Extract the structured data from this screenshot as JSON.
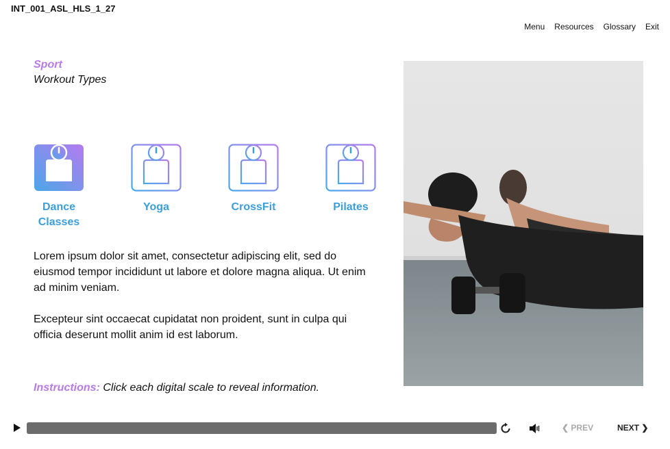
{
  "header": {
    "course_id": "INT_001_ASL_HLS_1_27",
    "nav": [
      "Menu",
      "Resources",
      "Glossary",
      "Exit"
    ]
  },
  "main": {
    "category": "Sport",
    "title": "Workout Types",
    "scales": [
      {
        "label": "Dance Classes",
        "active": true
      },
      {
        "label": "Yoga",
        "active": false
      },
      {
        "label": "CrossFit",
        "active": false
      },
      {
        "label": "Pilates",
        "active": false
      }
    ],
    "paragraphs": [
      "Lorem ipsum dolor sit amet, consectetur adipiscing elit, sed do eiusmod tempor incididunt ut labore et dolore magna aliqua. Ut enim ad minim veniam.",
      "Excepteur sint occaecat cupidatat non proident, sunt in culpa qui officia deserunt mollit anim id est laborum."
    ],
    "instructions_lead": "Instructions:",
    "instructions_text": " Click each digital scale to reveal information."
  },
  "player": {
    "progress": 1.0,
    "prev_label": "PREV",
    "next_label": "NEXT",
    "prev_enabled": false
  },
  "colors": {
    "accent_purple": "#b77be6",
    "accent_blue": "#3a9fda",
    "gradient_start": "#b57bf0",
    "gradient_end": "#4aa8e8"
  },
  "icons": [
    "play-icon",
    "replay-icon",
    "volume-icon",
    "chevron-left-icon",
    "chevron-right-icon",
    "scale-icon"
  ]
}
